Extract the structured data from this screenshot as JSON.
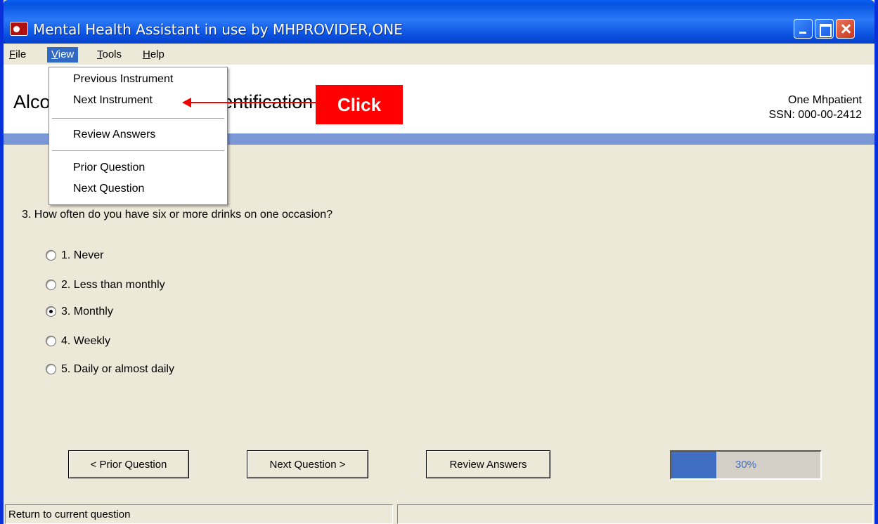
{
  "window": {
    "title": "Mental Health Assistant in use by MHPROVIDER,ONE"
  },
  "menubar": {
    "file": "File",
    "view": "View",
    "tools": "Tools",
    "help": "Help"
  },
  "view_menu": {
    "previous_instrument": "Previous Instrument",
    "next_instrument": "Next Instrument",
    "review_answers": "Review Answers",
    "prior_question": "Prior Question",
    "next_question": "Next Question"
  },
  "header": {
    "instrument_title": "Alcohol Use Disorders Identification Test",
    "patient_name": "One Mhpatient",
    "patient_ssn": "SSN: 000-00-2412"
  },
  "question": {
    "text": "3. How often do you have six or more drinks on one occasion?",
    "options": [
      {
        "label": "1. Never",
        "selected": false
      },
      {
        "label": "2. Less than monthly",
        "selected": false
      },
      {
        "label": "3. Monthly",
        "selected": true
      },
      {
        "label": "4. Weekly",
        "selected": false
      },
      {
        "label": "5. Daily or almost daily",
        "selected": false
      }
    ]
  },
  "buttons": {
    "prior_question": "< Prior Question",
    "next_question": "Next Question >",
    "review_answers": "Review Answers"
  },
  "progress": {
    "percent": 30,
    "label": "30%"
  },
  "statusbar": {
    "text": "Return to current question"
  },
  "annotation": {
    "click_label": "Click"
  },
  "colors": {
    "title_bar": "#0a52e0",
    "menu_highlight": "#316ac5",
    "header_band": "#7b98d6",
    "annotation": "#ff0000"
  }
}
